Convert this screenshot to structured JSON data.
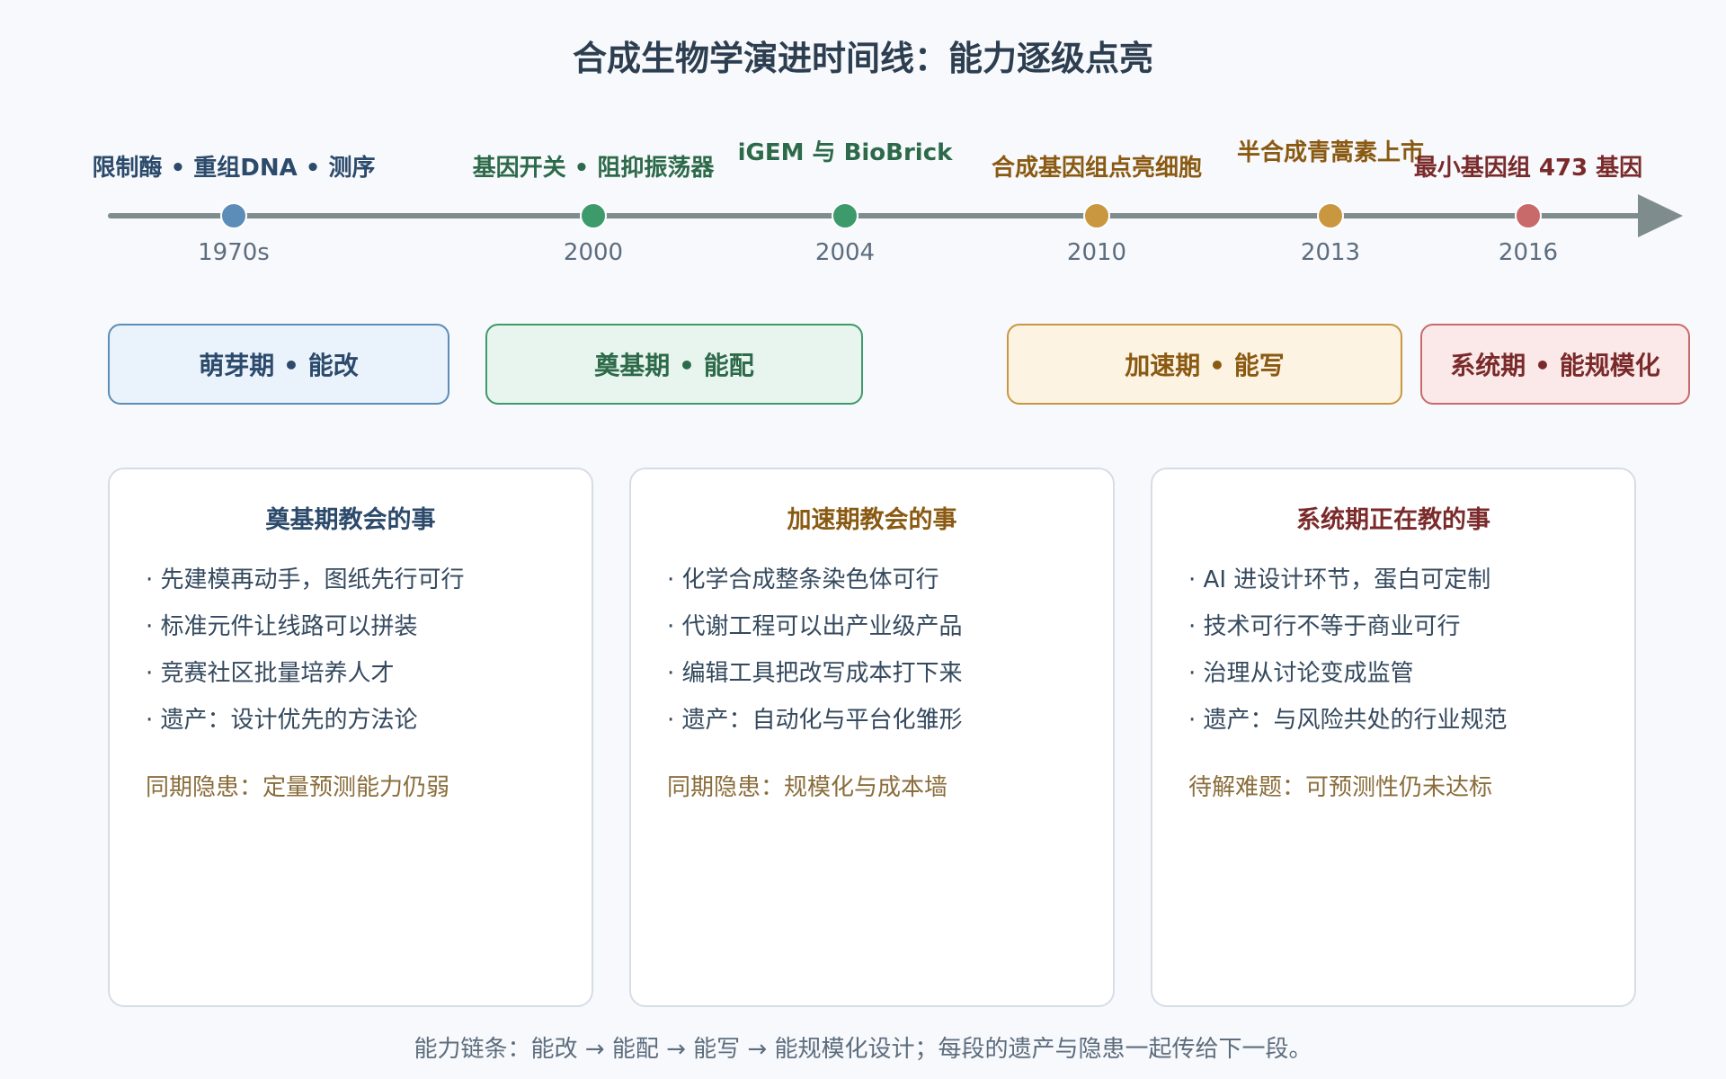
{
  "title": "合成生物学演进时间线：能力逐级点亮",
  "colors": {
    "blue": "#5b8db8",
    "green": "#3d9a6a",
    "gold": "#c9973f",
    "red": "#c96a6a",
    "axis": "#7f8c8d"
  },
  "timeline": [
    {
      "year": "1970s",
      "label": "限制酶 • 重组DNA • 测序"
    },
    {
      "year": "2000",
      "label": "基因开关 • 阻抑振荡器"
    },
    {
      "year": "2004",
      "label": "iGEM 与 BioBrick"
    },
    {
      "year": "2010",
      "label": "合成基因组点亮细胞"
    },
    {
      "year": "2013",
      "label": "半合成青蒿素上市"
    },
    {
      "year": "2016",
      "label": "最小基因组 473 基因"
    }
  ],
  "eras": [
    {
      "label": "萌芽期 • 能改"
    },
    {
      "label": "奠基期 • 能配"
    },
    {
      "label": "加速期 • 能写"
    },
    {
      "label": "系统期 • 能规模化"
    }
  ],
  "cards": [
    {
      "title": "奠基期教会的事",
      "items": [
        "· 先建模再动手，图纸先行可行",
        "· 标准元件让线路可以拼装",
        "· 竞赛社区批量培养人才",
        "· 遗产：设计优先的方法论"
      ],
      "note": "同期隐患：定量预测能力仍弱"
    },
    {
      "title": "加速期教会的事",
      "items": [
        "· 化学合成整条染色体可行",
        "· 代谢工程可以出产业级产品",
        "· 编辑工具把改写成本打下来",
        "· 遗产：自动化与平台化雏形"
      ],
      "note": "同期隐患：规模化与成本墙"
    },
    {
      "title": "系统期正在教的事",
      "items": [
        "· AI 进设计环节，蛋白可定制",
        "· 技术可行不等于商业可行",
        "· 治理从讨论变成监管",
        "· 遗产：与风险共处的行业规范"
      ],
      "note": "待解难题：可预测性仍未达标"
    }
  ],
  "footer": "能力链条：能改 → 能配 → 能写 → 能规模化设计；每段的遗产与隐患一起传给下一段。"
}
